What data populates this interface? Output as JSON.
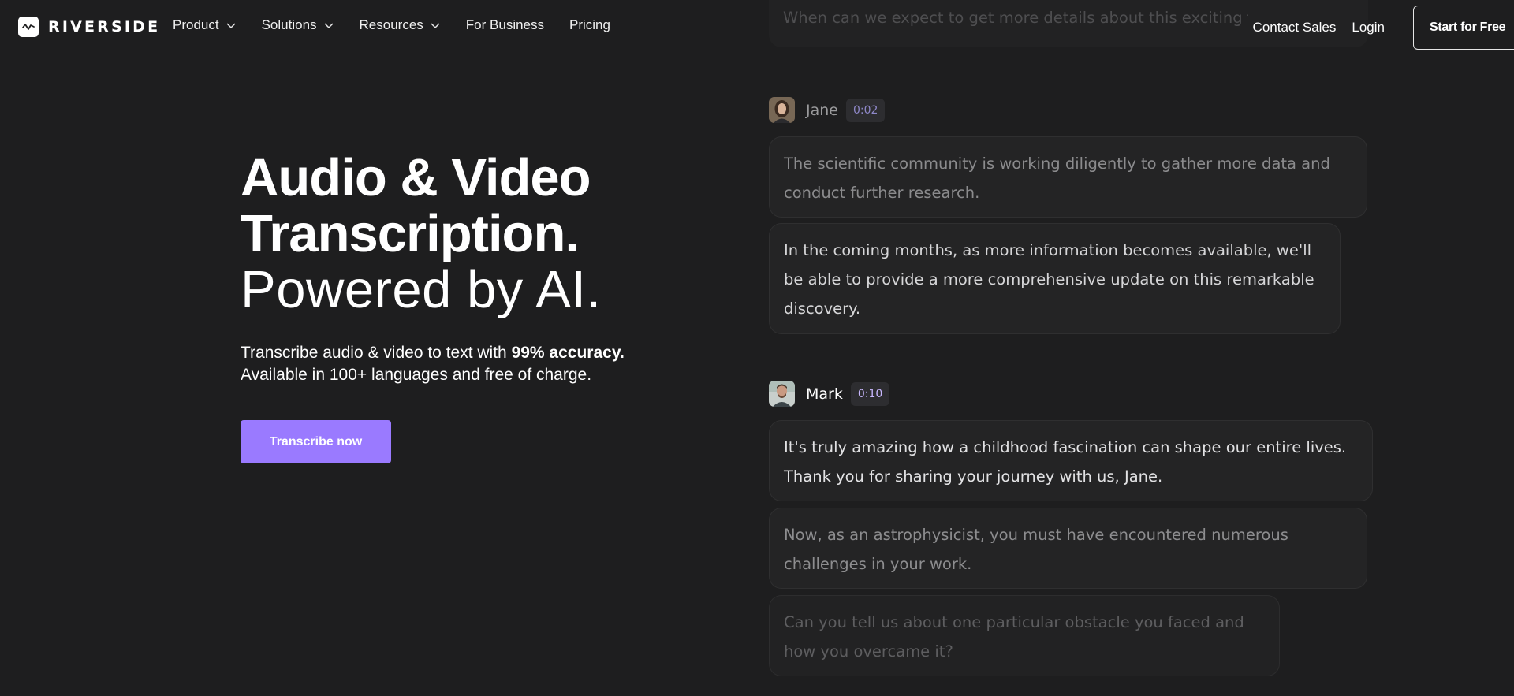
{
  "brand": {
    "name": "RIVERSIDE"
  },
  "nav": {
    "items": [
      {
        "label": "Product",
        "has_dropdown": true
      },
      {
        "label": "Solutions",
        "has_dropdown": true
      },
      {
        "label": "Resources",
        "has_dropdown": true
      },
      {
        "label": "For Business",
        "has_dropdown": false
      },
      {
        "label": "Pricing",
        "has_dropdown": false
      }
    ],
    "contact_sales": "Contact Sales",
    "login": "Login",
    "start_free": "Start for Free"
  },
  "hero": {
    "title_line1": "Audio & Video",
    "title_line2": "Transcription.",
    "title_line3": "Powered by AI.",
    "subtitle_prefix": "Transcribe audio & video to text with ",
    "subtitle_bold": "99% accuracy.",
    "subtitle_line2": "Available in 100+ languages and free of charge.",
    "cta_label": "Transcribe now"
  },
  "transcript": {
    "top_faded_text": "When can we expect to get more details about this exciting find?",
    "speakers": [
      {
        "name": "Jane",
        "time": "0:02",
        "messages": [
          "The scientific community is working diligently to gather more data and conduct further research.",
          " In the coming months, as more information becomes available, we'll be able to provide a more comprehensive update on this remarkable discovery."
        ]
      },
      {
        "name": "Mark",
        "time": "0:10",
        "messages": [
          "It's truly amazing how a childhood fascination can shape our entire lives. Thank you for sharing your journey with us, Jane.",
          "Now, as an astrophysicist, you must have encountered numerous challenges in your work.",
          "Can you tell us about one particular obstacle you faced and how you overcame it?"
        ]
      }
    ]
  },
  "colors": {
    "background": "#1e1e1f",
    "accent": "#9a7aff",
    "badge_text_jane": "#8f88c9",
    "badge_text_mark": "#c9b8ff"
  }
}
